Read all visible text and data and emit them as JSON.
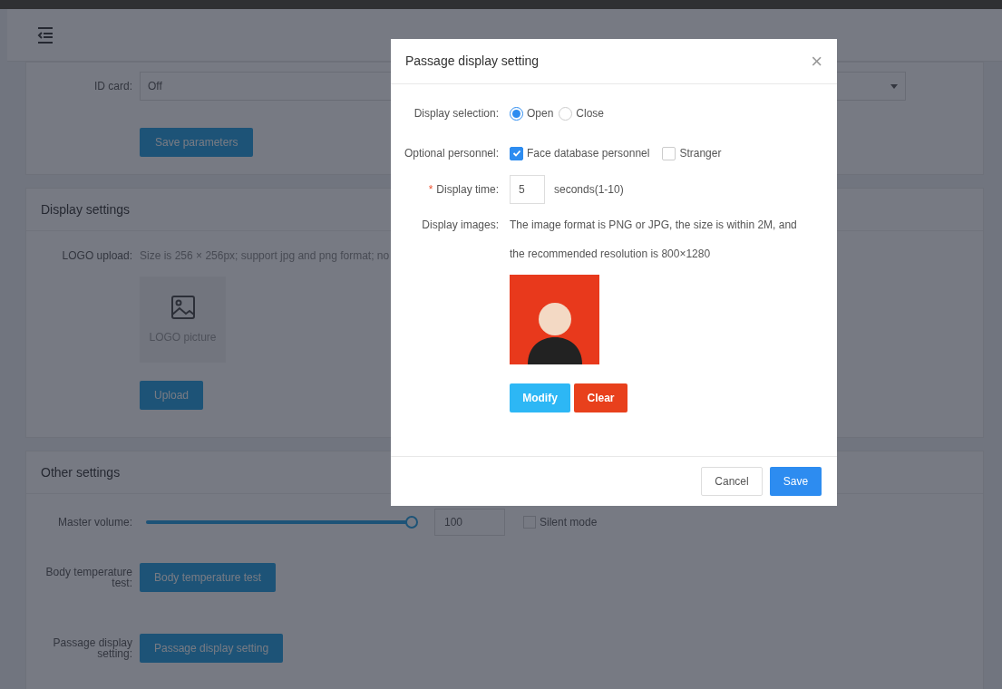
{
  "id_card": {
    "label": "ID card:",
    "value": "Off"
  },
  "save_parameters": "Save parameters",
  "display_settings": {
    "title": "Display settings",
    "logo_label": "LOGO upload:",
    "logo_hint": "Size is 256 × 256px; support jpg and png format; no",
    "logo_placeholder": "LOGO picture",
    "upload": "Upload"
  },
  "other_settings": {
    "title": "Other settings",
    "volume_label": "Master volume:",
    "volume": {
      "level": 1.0,
      "reading": "100"
    },
    "silent": {
      "label": "Silent mode",
      "checked": false
    },
    "body_temp_label": "Body temperature test:",
    "body_temp_button": "Body temperature test",
    "passage_label": "Passage display setting:",
    "passage_button": "Passage display setting"
  },
  "dialog": {
    "title": "Passage display setting",
    "close": "×",
    "display_selection": {
      "label": "Display selection:",
      "options": [
        {
          "label": "Open",
          "selected": true
        },
        {
          "label": "Close",
          "selected": false
        }
      ]
    },
    "optional_personnel": {
      "label": "Optional personnel:",
      "options": [
        {
          "label": "Face database personnel",
          "checked": true
        },
        {
          "label": "Stranger",
          "checked": false
        }
      ]
    },
    "display_time": {
      "required_mark": "*",
      "label": "Display time:",
      "value": "5",
      "unit": "seconds(1-10)"
    },
    "display_images": {
      "label": "Display images:",
      "hint_lines": [
        "The image format is PNG or JPG, the size is within 2M, and",
        "the recommended resolution is 800×1280"
      ],
      "modify": "Modify",
      "clear": "Clear"
    },
    "cancel": "Cancel",
    "save": "Save"
  }
}
